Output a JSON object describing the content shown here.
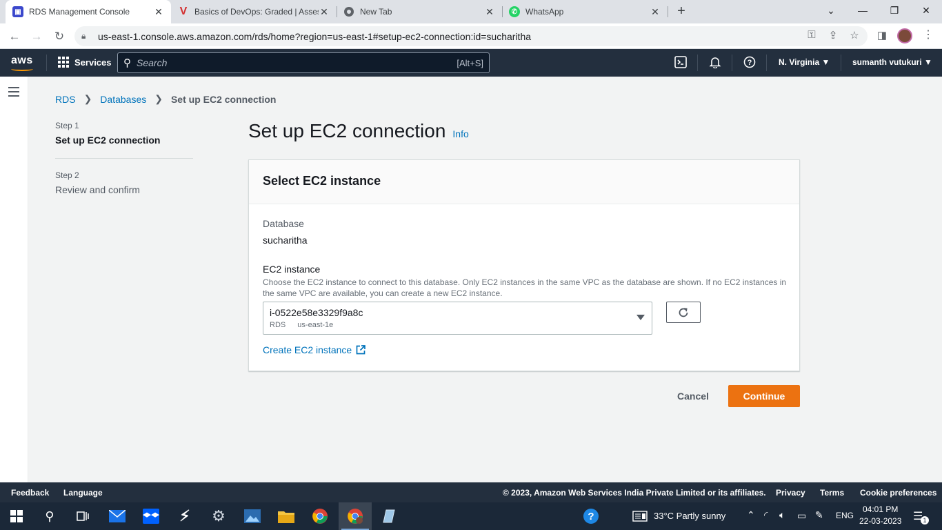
{
  "browser": {
    "tabs": [
      {
        "title": "RDS Management Console",
        "favicon": "rds-icon",
        "color": "#3b48cc",
        "active": true
      },
      {
        "title": "Basics of DevOps: Graded | Asses",
        "favicon": "v-logo-icon",
        "color": "#d32f2f",
        "active": false
      },
      {
        "title": "New Tab",
        "favicon": "chrome-icon",
        "color": "#5f6368",
        "active": false
      },
      {
        "title": "WhatsApp",
        "favicon": "whatsapp-icon",
        "color": "#25d366",
        "active": false
      }
    ],
    "url": "us-east-1.console.aws.amazon.com/rds/home?region=us-east-1#setup-ec2-connection:id=sucharitha"
  },
  "awsnav": {
    "logo": "aws",
    "services_label": "Services",
    "search_placeholder": "Search",
    "search_shortcut": "[Alt+S]",
    "region": "N. Virginia ▼",
    "user": "sumanth vutukuri ▼"
  },
  "breadcrumb": {
    "items": [
      "RDS",
      "Databases",
      "Set up EC2 connection"
    ]
  },
  "steps": [
    {
      "number": "Step 1",
      "title": "Set up EC2 connection"
    },
    {
      "number": "Step 2",
      "title": "Review and confirm"
    }
  ],
  "page": {
    "title": "Set up EC2 connection",
    "info_link": "Info"
  },
  "panel": {
    "title": "Select EC2 instance",
    "database_label": "Database",
    "database_value": "sucharitha",
    "ec2_label": "EC2 instance",
    "ec2_description": "Choose the EC2 instance to connect to this database. Only EC2 instances in the same VPC as the database are shown. If no EC2 instances in the same VPC are available, you can create a new EC2 instance.",
    "selected_instance": "i-0522e58e3329f9a8c",
    "selected_tag1": "RDS",
    "selected_tag2": "us-east-1e",
    "create_link": "Create EC2 instance"
  },
  "actions": {
    "cancel": "Cancel",
    "continue": "Continue",
    "continue_color": "#ec7211"
  },
  "footer": {
    "feedback": "Feedback",
    "language": "Language",
    "copyright": "© 2023, Amazon Web Services India Private Limited or its affiliates.",
    "privacy": "Privacy",
    "terms": "Terms",
    "cookies": "Cookie preferences"
  },
  "taskbar": {
    "weather": "33°C  Partly sunny",
    "lang": "ENG",
    "time": "04:01 PM",
    "date": "22-03-2023",
    "notifications": "1"
  }
}
